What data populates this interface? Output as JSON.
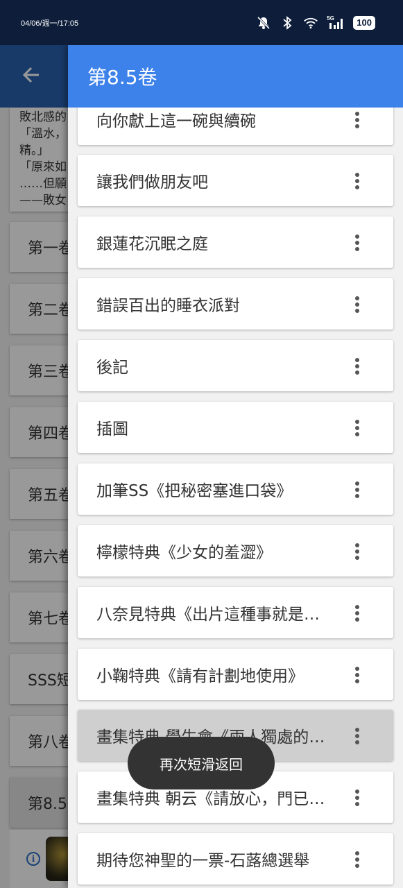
{
  "status_bar": {
    "time": "04/06/週一/17:05",
    "signal": "5G",
    "battery": "100",
    "icons": [
      "mute-bell-icon",
      "bluetooth-icon",
      "wifi-icon",
      "signal-icon",
      "battery-icon"
    ]
  },
  "background": {
    "description_lines": [
      "敗北感的",
      "「溫水，",
      "精。」",
      "「原來如",
      "……但願",
      "——敗女"
    ],
    "volumes": [
      "第一卷",
      "第二卷",
      "第三卷",
      "第四卷",
      "第五卷",
      "第六卷",
      "第七卷",
      "SSS短",
      "第八卷",
      "第8.5"
    ],
    "selected_volume_index": 9
  },
  "drawer": {
    "title": "第8.5卷",
    "chapters": [
      "向你獻上這一碗與續碗",
      "讓我們做朋友吧",
      "銀蓮花沉眠之庭",
      "錯誤百出的睡衣派對",
      "後記",
      "插圖",
      "加筆SS《把秘密塞進口袋》",
      "檸檬特典《少女的羞澀》",
      "八奈見特典《出片這種事就是靠數量取勝",
      "小鞠特典《請有計劃地使用》",
      "畫集特典 學生會《兩人獨處的時光》",
      "畫集特典 朝云《請放心，門已經鎖好了》",
      "期待您神聖的一票-石蕗總選舉"
    ],
    "highlighted_index": 10
  },
  "toast": {
    "text": "再次短滑返回"
  },
  "colors": {
    "status_bar": "#0d1d3a",
    "drawer_header": "#3d82ea",
    "background_appbar": "#2962b0",
    "highlight_row": "#cfcfcf"
  }
}
